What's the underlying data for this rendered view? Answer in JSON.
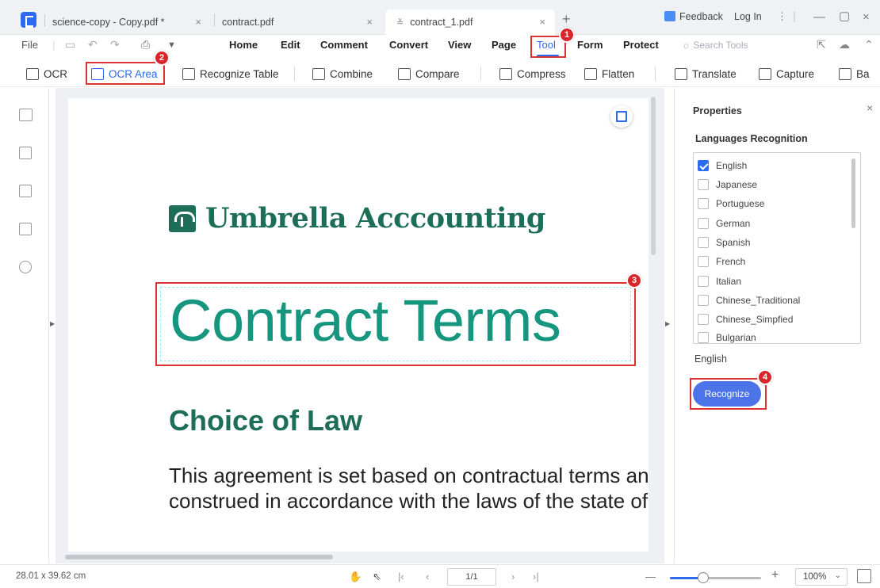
{
  "tabs": [
    {
      "label": "science-copy - Copy.pdf *"
    },
    {
      "label": "contract.pdf"
    },
    {
      "label": "contract_1.pdf"
    }
  ],
  "titlebar": {
    "feedback": "Feedback",
    "login": "Log In"
  },
  "menu": {
    "file": "File",
    "items": [
      "Home",
      "Edit",
      "Comment",
      "Convert",
      "View",
      "Page",
      "Tool",
      "Form",
      "Protect"
    ],
    "search_placeholder": "Search Tools"
  },
  "toolbar": {
    "items": [
      "OCR",
      "OCR Area",
      "Recognize Table",
      "Combine",
      "Compare",
      "Compress",
      "Flatten",
      "Translate",
      "Capture",
      "Ba"
    ]
  },
  "document": {
    "brand": "Umbrella Acccounting",
    "title": "Contract Terms",
    "heading": "Choice of Law",
    "paragraph_line1": "This agreement is set based on contractual terms and",
    "paragraph_line2": "construed in accordance with the laws of the state of"
  },
  "properties": {
    "title": "Properties",
    "section": "Languages Recognition",
    "languages": [
      {
        "name": "English",
        "checked": true
      },
      {
        "name": "Japanese",
        "checked": false
      },
      {
        "name": "Portuguese",
        "checked": false
      },
      {
        "name": "German",
        "checked": false
      },
      {
        "name": "Spanish",
        "checked": false
      },
      {
        "name": "French",
        "checked": false
      },
      {
        "name": "Italian",
        "checked": false
      },
      {
        "name": "Chinese_Traditional",
        "checked": false
      },
      {
        "name": "Chinese_Simpfied",
        "checked": false
      },
      {
        "name": "Bulgarian",
        "checked": false
      }
    ],
    "selected_summary": "English",
    "recognize_label": "Recognize"
  },
  "badges": [
    "1",
    "2",
    "3",
    "4"
  ],
  "status": {
    "dimensions": "28.01 x 39.62 cm",
    "page_display": "1/1",
    "zoom": "100%",
    "zoom_level": 0.33
  },
  "colors": {
    "accent": "#2c6bf0",
    "highlight": "#dd3333",
    "brand_green": "#1d6e58",
    "title_teal": "#17967f"
  }
}
